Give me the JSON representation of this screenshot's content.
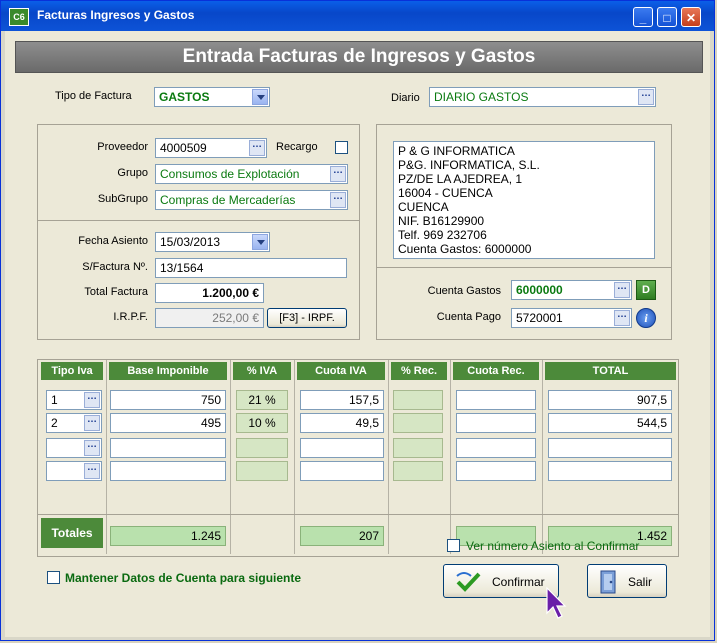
{
  "window": {
    "title": "Facturas Ingresos y Gastos",
    "icon_text": "C6"
  },
  "header": {
    "title": "Entrada Facturas de Ingresos y Gastos"
  },
  "form": {
    "tipo_factura_label": "Tipo de Factura",
    "tipo_factura_value": "GASTOS",
    "diario_label": "Diario",
    "diario_value": "DIARIO GASTOS",
    "proveedor_label": "Proveedor",
    "proveedor_value": "4000509",
    "recargo_label": "Recargo",
    "grupo_label": "Grupo",
    "grupo_value": "Consumos de Explotación",
    "subgrupo_label": "SubGrupo",
    "subgrupo_value": "Compras de Mercaderías",
    "fecha_label": "Fecha Asiento",
    "fecha_value": "15/03/2013",
    "sfactura_label": "S/Factura Nº.",
    "sfactura_value": "13/1564",
    "total_label": "Total Factura",
    "total_value": "1.200,00 €",
    "irpf_label": "I.R.P.F.",
    "irpf_value": "252,00 €",
    "irpf_button": "[F3] - IRPF.",
    "address_lines": [
      "P & G INFORMATICA",
      "P&G. INFORMATICA, S.L.",
      "PZ/DE LA AJEDREA, 1",
      "16004 - CUENCA",
      "CUENCA",
      "NIF. B16129900",
      "Telf. 969 232706",
      "Cuenta Gastos: 6000000"
    ],
    "cuenta_gastos_label": "Cuenta Gastos",
    "cuenta_gastos_value": "6000000",
    "cuenta_gastos_btn": "D",
    "cuenta_pago_label": "Cuenta Pago",
    "cuenta_pago_value": "5720001"
  },
  "grid": {
    "headers": [
      "Tipo Iva",
      "Base Imponible",
      "% IVA",
      "Cuota IVA",
      "% Rec.",
      "Cuota Rec.",
      "TOTAL"
    ],
    "rows": [
      {
        "tipo": "1",
        "base": "750",
        "iva": "21 %",
        "cuota": "157,5",
        "rec": "",
        "cuota_rec": "",
        "total": "907,5"
      },
      {
        "tipo": "2",
        "base": "495",
        "iva": "10 %",
        "cuota": "49,5",
        "rec": "",
        "cuota_rec": "",
        "total": "544,5"
      },
      {
        "tipo": "",
        "base": "",
        "iva": "",
        "cuota": "",
        "rec": "",
        "cuota_rec": "",
        "total": ""
      },
      {
        "tipo": "",
        "base": "",
        "iva": "",
        "cuota": "",
        "rec": "",
        "cuota_rec": "",
        "total": ""
      }
    ],
    "totals_label": "Totales",
    "totals": {
      "base": "1.245",
      "cuota": "207",
      "total": "1.452"
    }
  },
  "footer": {
    "ver_numero_label": "Ver número Asiento al Confirmar",
    "mantener_label": "Mantener Datos de Cuenta para siguiente",
    "confirmar_label": "Confirmar",
    "salir_label": "Salir"
  }
}
